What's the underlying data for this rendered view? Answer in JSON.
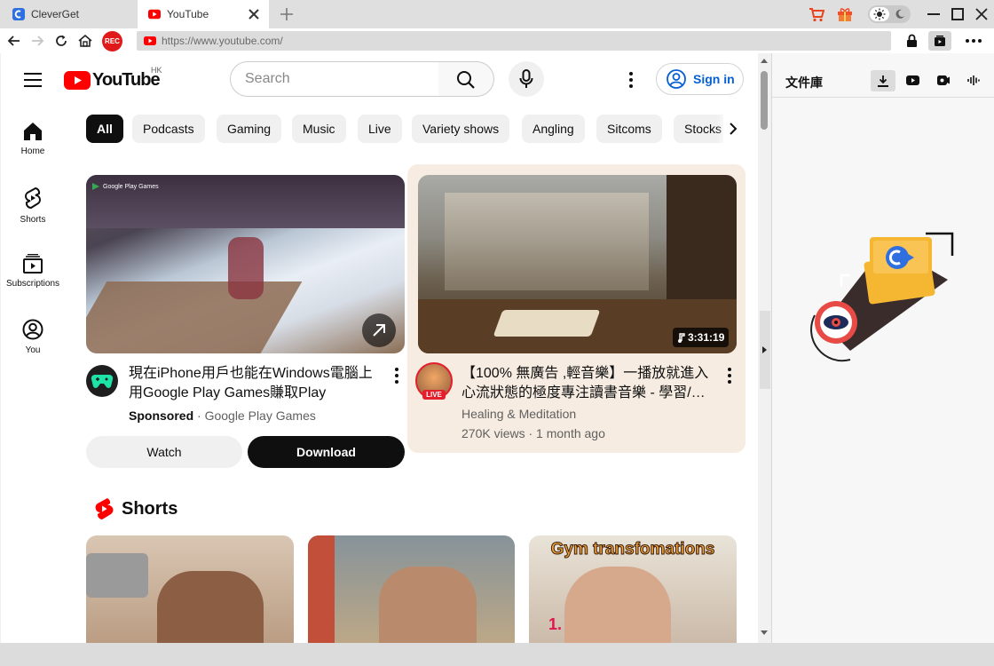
{
  "browser": {
    "tabs": [
      {
        "label": "CleverGet"
      },
      {
        "label": "YouTube"
      }
    ],
    "url": "https://www.youtube.com/",
    "rec_label": "REC"
  },
  "youtube": {
    "logo_text": "YouTube",
    "region": "HK",
    "search_placeholder": "Search",
    "sign_in": "Sign in",
    "chips": [
      "All",
      "Podcasts",
      "Gaming",
      "Music",
      "Live",
      "Variety shows",
      "Angling",
      "Sitcoms",
      "Stocks"
    ],
    "sidebar": [
      {
        "label": "Home",
        "icon": "home-icon"
      },
      {
        "label": "Shorts",
        "icon": "shorts-icon"
      },
      {
        "label": "Subscriptions",
        "icon": "subscriptions-icon"
      },
      {
        "label": "You",
        "icon": "you-icon"
      }
    ],
    "videos": [
      {
        "thumb_logo": "Google Play Games",
        "title": "現在iPhone用戶也能在Windows電腦上用Google Play Games賺取Play Points。",
        "sponsored": "Sponsored",
        "channel": "Google Play Games",
        "watch": "Watch",
        "download": "Download"
      },
      {
        "title": "【100% 無廣告 ,輕音樂】一播放就進入心流狀態的極度專注讀書音樂 - 學習/…",
        "duration": "3:31:19",
        "channel": "Healing & Meditation",
        "stats": "270K views · 1 month ago",
        "live_badge": "LIVE"
      }
    ],
    "shorts_heading": "Shorts",
    "shorts_caption": "Gym transfomations",
    "shorts_marker": "1."
  },
  "panel": {
    "title": "文件庫"
  },
  "colors": {
    "yt_red": "#ff0000",
    "sign_in_blue": "#065fd4",
    "highlight_card": "#f6ece1",
    "cleverget_yellow": "#f5b731"
  }
}
